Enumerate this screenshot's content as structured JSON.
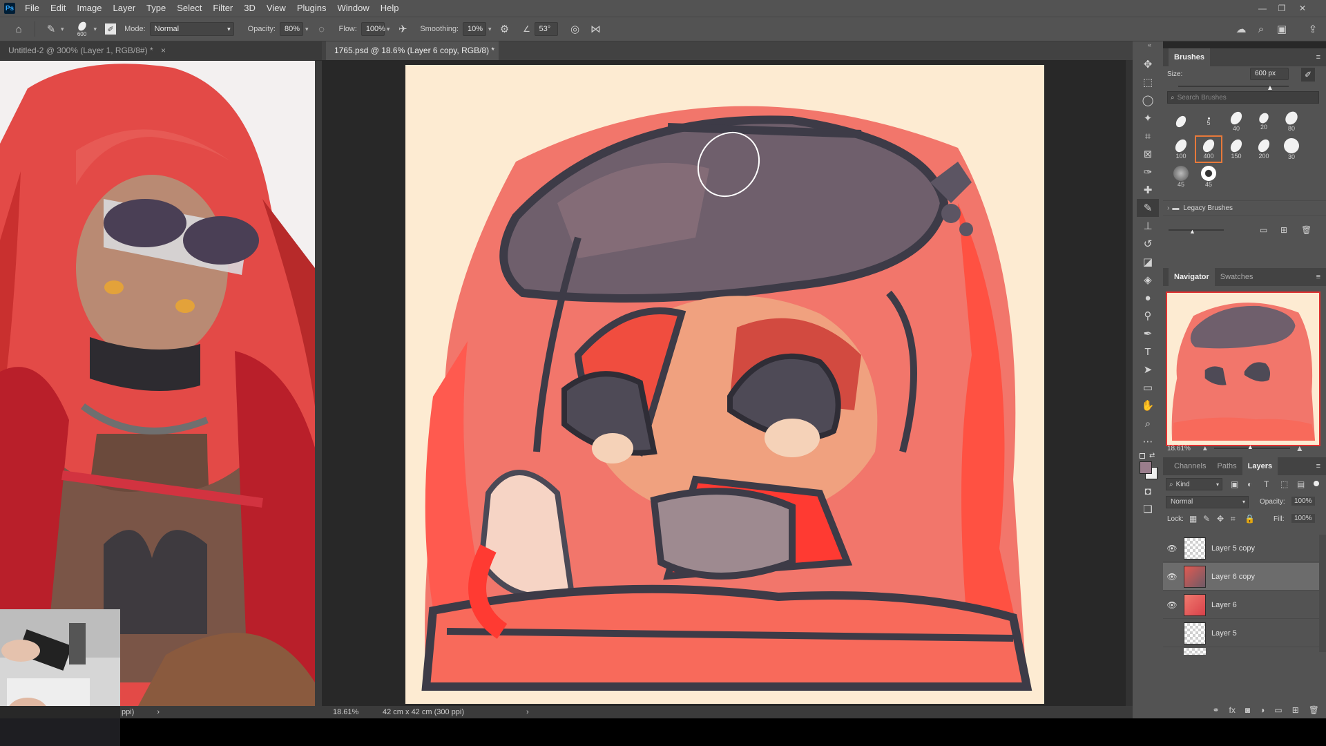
{
  "app": {
    "logo": "Ps",
    "theme_colors": {
      "ui_bg": "#535353",
      "panel_head": "#434343",
      "canvas_bg": "#282828",
      "accent": "#e8793a"
    }
  },
  "menu": [
    "File",
    "Edit",
    "Image",
    "Layer",
    "Type",
    "Select",
    "Filter",
    "3D",
    "View",
    "Plugins",
    "Window",
    "Help"
  ],
  "options": {
    "brush_size": "600",
    "mode_label": "Mode:",
    "mode_value": "Normal",
    "opacity_label": "Opacity:",
    "opacity_value": "80%",
    "flow_label": "Flow:",
    "flow_value": "100%",
    "smoothing_label": "Smoothing:",
    "smoothing_value": "10%",
    "angle_value": "53°"
  },
  "tabs": [
    {
      "title": "Untitled-2 @ 300% (Layer 1, RGB/8#) *",
      "close": "×"
    },
    {
      "title": "1765.psd @ 18.6% (Layer 6 copy, RGB/8) *",
      "close": "×"
    }
  ],
  "status": {
    "left_partial": "ppi)",
    "zoom": "18.61%",
    "doc_size": "42 cm x 42 cm (300 ppi)",
    "arrow": "›"
  },
  "brushes_panel": {
    "title": "Brushes",
    "size_label": "Size:",
    "size_value": "600 px",
    "search_placeholder": "Search Brushes",
    "presets": [
      {
        "n": ""
      },
      {
        "n": "5"
      },
      {
        "n": "40"
      },
      {
        "n": "20"
      },
      {
        "n": "80"
      },
      {
        "n": "100"
      },
      {
        "n": "400"
      },
      {
        "n": "150"
      },
      {
        "n": "200"
      },
      {
        "n": "30"
      },
      {
        "n": "45"
      },
      {
        "n": "45"
      }
    ],
    "group_label": "Legacy Brushes"
  },
  "navigator": {
    "tabs": [
      "Navigator",
      "Swatches"
    ],
    "zoom": "18.61%"
  },
  "layers_panel": {
    "tabs": [
      "Channels",
      "Paths",
      "Layers"
    ],
    "filter_label": "Kind",
    "blend_mode": "Normal",
    "opacity_label": "Opacity:",
    "opacity_value": "100%",
    "lock_label": "Lock:",
    "fill_label": "Fill:",
    "fill_value": "100%",
    "layers": [
      {
        "name": "Layer 5 copy",
        "visible": true,
        "selected": false
      },
      {
        "name": "Layer 6 copy",
        "visible": true,
        "selected": true
      },
      {
        "name": "Layer 6",
        "visible": true,
        "selected": false
      },
      {
        "name": "Layer 5",
        "visible": false,
        "selected": false
      }
    ]
  }
}
